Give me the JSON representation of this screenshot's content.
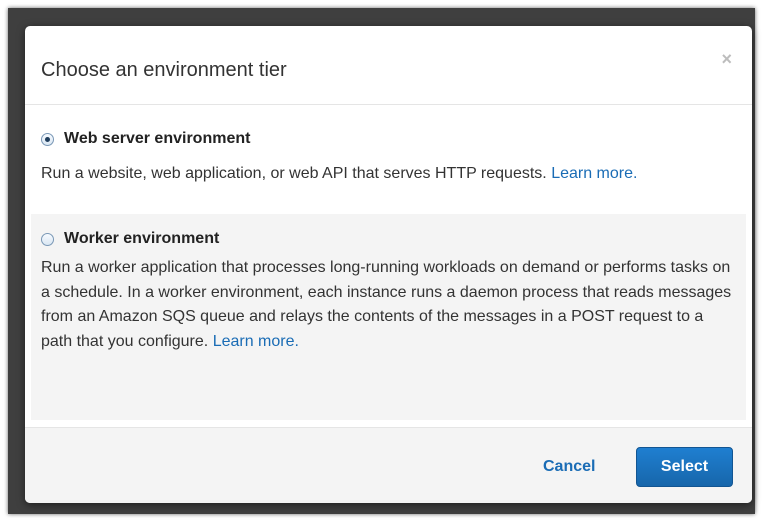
{
  "modal": {
    "title": "Choose an environment tier",
    "close_glyph": "×"
  },
  "options": [
    {
      "title": "Web server environment",
      "selected": true,
      "description": "Run a website, web application, or web API that serves HTTP requests.",
      "link": "Learn more."
    },
    {
      "title": "Worker environment",
      "selected": false,
      "description": "Run a worker application that processes long-running workloads on demand or performs tasks on a schedule. In a worker environment, each instance runs a daemon process that reads messages from an Amazon SQS queue and relays the contents of the messages in a POST request to a path that you configure.",
      "link": "Learn more."
    }
  ],
  "footer": {
    "cancel_label": "Cancel",
    "select_label": "Select"
  },
  "background": {
    "fragment_1": "",
    "fragment_2": ""
  },
  "colors": {
    "accent": "#1a6cb5",
    "primary_button": "#1766ab",
    "overlay": "#3f3f3f"
  }
}
